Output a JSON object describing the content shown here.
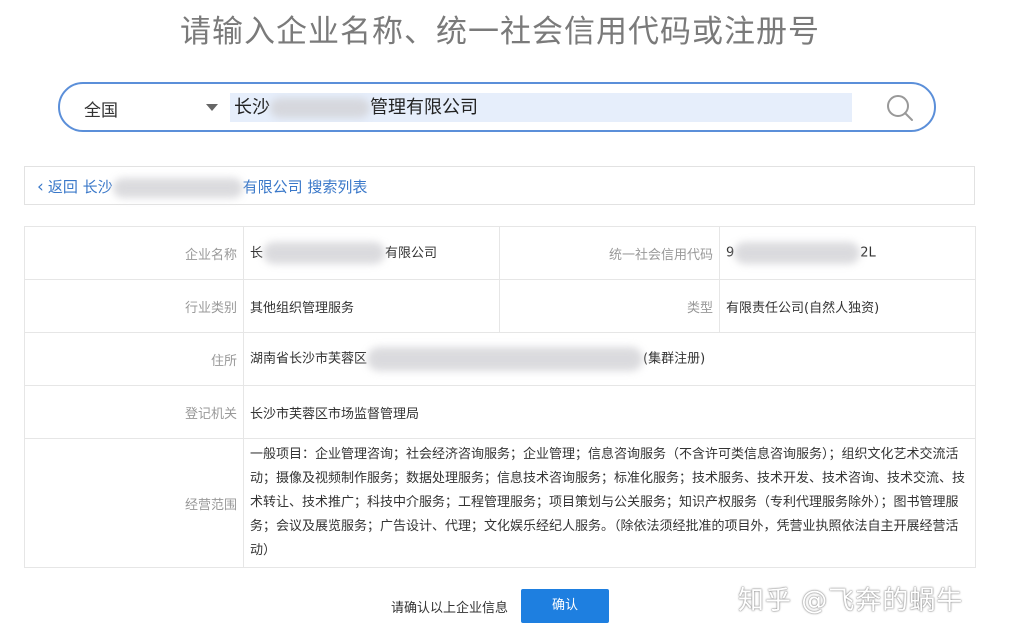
{
  "page_title": "请输入企业名称、统一社会信用代码或注册号",
  "search": {
    "region": "全国",
    "query_prefix": "长沙",
    "query_suffix": "管理有限公司"
  },
  "back": {
    "prefix": "返回 长沙",
    "suffix": "有限公司 搜索列表"
  },
  "details": {
    "name_label": "企业名称",
    "name_prefix": "长",
    "name_suffix": "有限公司",
    "credit_label": "统一社会信用代码",
    "credit_prefix": "9",
    "credit_suffix": "2L",
    "industry_label": "行业类别",
    "industry_value": "其他组织管理服务",
    "type_label": "类型",
    "type_value": "有限责任公司(自然人独资)",
    "address_label": "住所",
    "address_prefix": "湖南省长沙市芙蓉区",
    "address_suffix": "(集群注册)",
    "authority_label": "登记机关",
    "authority_value": "长沙市芙蓉区市场监督管理局",
    "scope_label": "经营范围",
    "scope_value": "一般项目：企业管理咨询；社会经济咨询服务；企业管理；信息咨询服务（不含许可类信息咨询服务）；组织文化艺术交流活动；摄像及视频制作服务；数据处理服务；信息技术咨询服务；标准化服务；技术服务、技术开发、技术咨询、技术交流、技术转让、技术推广；科技中介服务；工程管理服务；项目策划与公关服务；知识产权服务（专利代理服务除外）；图书管理服务；会议及展览服务；广告设计、代理；文化娱乐经纪人服务。（除依法须经批准的项目外，凭营业执照依法自主开展经营活动）"
  },
  "confirm": {
    "prompt": "请确认以上企业信息",
    "button": "确认"
  },
  "watermark": "知乎 @飞奔的蜗牛"
}
